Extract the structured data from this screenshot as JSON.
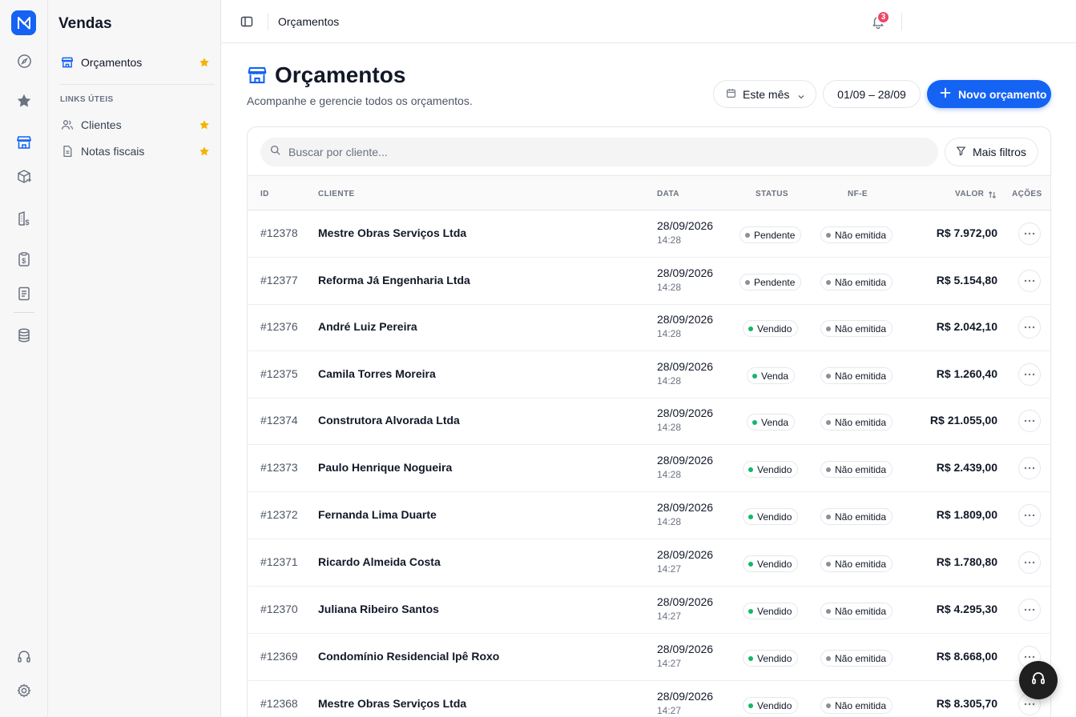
{
  "colors": {
    "accent": "#1463f3",
    "star": "#f5b400",
    "badge": "#ef4466",
    "dot_pending": "#8a8f98",
    "dot_sold": "#12b76a"
  },
  "rail": {
    "icons": [
      "app-logo-icon",
      "compass-icon",
      "star-icon",
      "store-icon",
      "box-arrow-icon",
      "building-dollar-icon",
      "clipboard-dollar-icon",
      "receipt-icon",
      "database-icon",
      "headset-icon",
      "gear-icon"
    ]
  },
  "sidebar": {
    "title": "Vendas",
    "active_item": {
      "label": "Orçamentos"
    },
    "section_label": "LINKS ÚTEIS",
    "links": [
      {
        "label": "Clientes"
      },
      {
        "label": "Notas fiscais"
      }
    ]
  },
  "topbar": {
    "breadcrumb": "Orçamentos",
    "notifications": "3"
  },
  "page": {
    "title": "Orçamentos",
    "subtitle": "Acompanhe e gerencie todos os orçamentos.",
    "period_label": "Este mês",
    "range_label": "01/09 – 28/09",
    "new_button": "Novo orçamento"
  },
  "filters": {
    "search_placeholder": "Buscar por cliente...",
    "more_filters": "Mais filtros"
  },
  "table": {
    "columns": {
      "id": "ID",
      "client": "CLIENTE",
      "date": "DATA",
      "status": "STATUS",
      "nfe": "NF-E",
      "value": "VALOR",
      "actions": "AÇÕES"
    },
    "rows": [
      {
        "id": "#12378",
        "client": "Mestre Obras Serviços Ltda",
        "date": "28/09/2026",
        "time": "14:28",
        "status": "Pendente",
        "nfe": "Não emitida",
        "value": "R$ 7.972,00"
      },
      {
        "id": "#12377",
        "client": "Reforma Já Engenharia Ltda",
        "date": "28/09/2026",
        "time": "14:28",
        "status": "Pendente",
        "nfe": "Não emitida",
        "value": "R$ 5.154,80"
      },
      {
        "id": "#12376",
        "client": "André Luiz Pereira",
        "date": "28/09/2026",
        "time": "14:28",
        "status": "Vendido",
        "nfe": "Não emitida",
        "value": "R$ 2.042,10"
      },
      {
        "id": "#12375",
        "client": "Camila Torres Moreira",
        "date": "28/09/2026",
        "time": "14:28",
        "status": "Venda",
        "nfe": "Não emitida",
        "value": "R$ 1.260,40"
      },
      {
        "id": "#12374",
        "client": "Construtora Alvorada Ltda",
        "date": "28/09/2026",
        "time": "14:28",
        "status": "Venda",
        "nfe": "Não emitida",
        "value": "R$ 21.055,00"
      },
      {
        "id": "#12373",
        "client": "Paulo Henrique Nogueira",
        "date": "28/09/2026",
        "time": "14:28",
        "status": "Vendido",
        "nfe": "Não emitida",
        "value": "R$ 2.439,00"
      },
      {
        "id": "#12372",
        "client": "Fernanda Lima Duarte",
        "date": "28/09/2026",
        "time": "14:28",
        "status": "Vendido",
        "nfe": "Não emitida",
        "value": "R$ 1.809,00"
      },
      {
        "id": "#12371",
        "client": "Ricardo Almeida Costa",
        "date": "28/09/2026",
        "time": "14:27",
        "status": "Vendido",
        "nfe": "Não emitida",
        "value": "R$ 1.780,80"
      },
      {
        "id": "#12370",
        "client": "Juliana Ribeiro Santos",
        "date": "28/09/2026",
        "time": "14:27",
        "status": "Vendido",
        "nfe": "Não emitida",
        "value": "R$ 4.295,30"
      },
      {
        "id": "#12369",
        "client": "Condomínio Residencial Ipê Roxo",
        "date": "28/09/2026",
        "time": "14:27",
        "status": "Vendido",
        "nfe": "Não emitida",
        "value": "R$ 8.668,00"
      },
      {
        "id": "#12368",
        "client": "Mestre Obras Serviços Ltda",
        "date": "28/09/2026",
        "time": "14:27",
        "status": "Vendido",
        "nfe": "Não emitida",
        "value": "R$ 8.305,70"
      }
    ]
  }
}
